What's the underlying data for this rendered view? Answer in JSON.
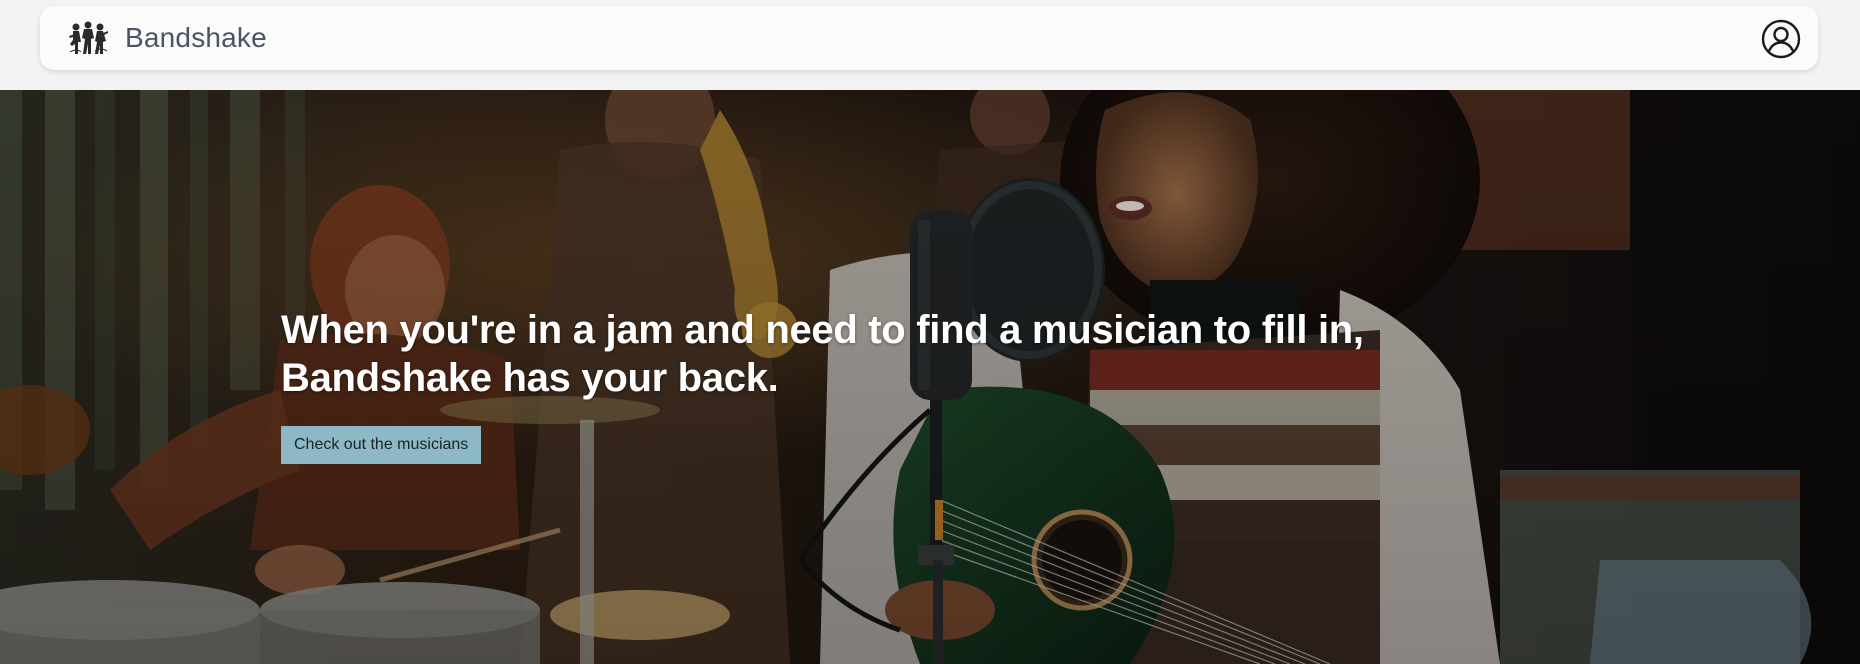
{
  "header": {
    "brand_name": "Bandshake",
    "logo_icon": "band-logo-icon",
    "account_icon": "user-circle-icon"
  },
  "hero": {
    "headline": "When you're in a jam and need to find a musician to fill in, Bandshake has your back.",
    "cta_label": "Check out the musicians"
  },
  "colors": {
    "page_background": "#f3f3f3",
    "navbar_background": "#fbfbfb",
    "brand_text": "#4a5563",
    "cta_background": "#8db9c6",
    "cta_text": "#1c2328",
    "hero_text": "#ffffff"
  }
}
